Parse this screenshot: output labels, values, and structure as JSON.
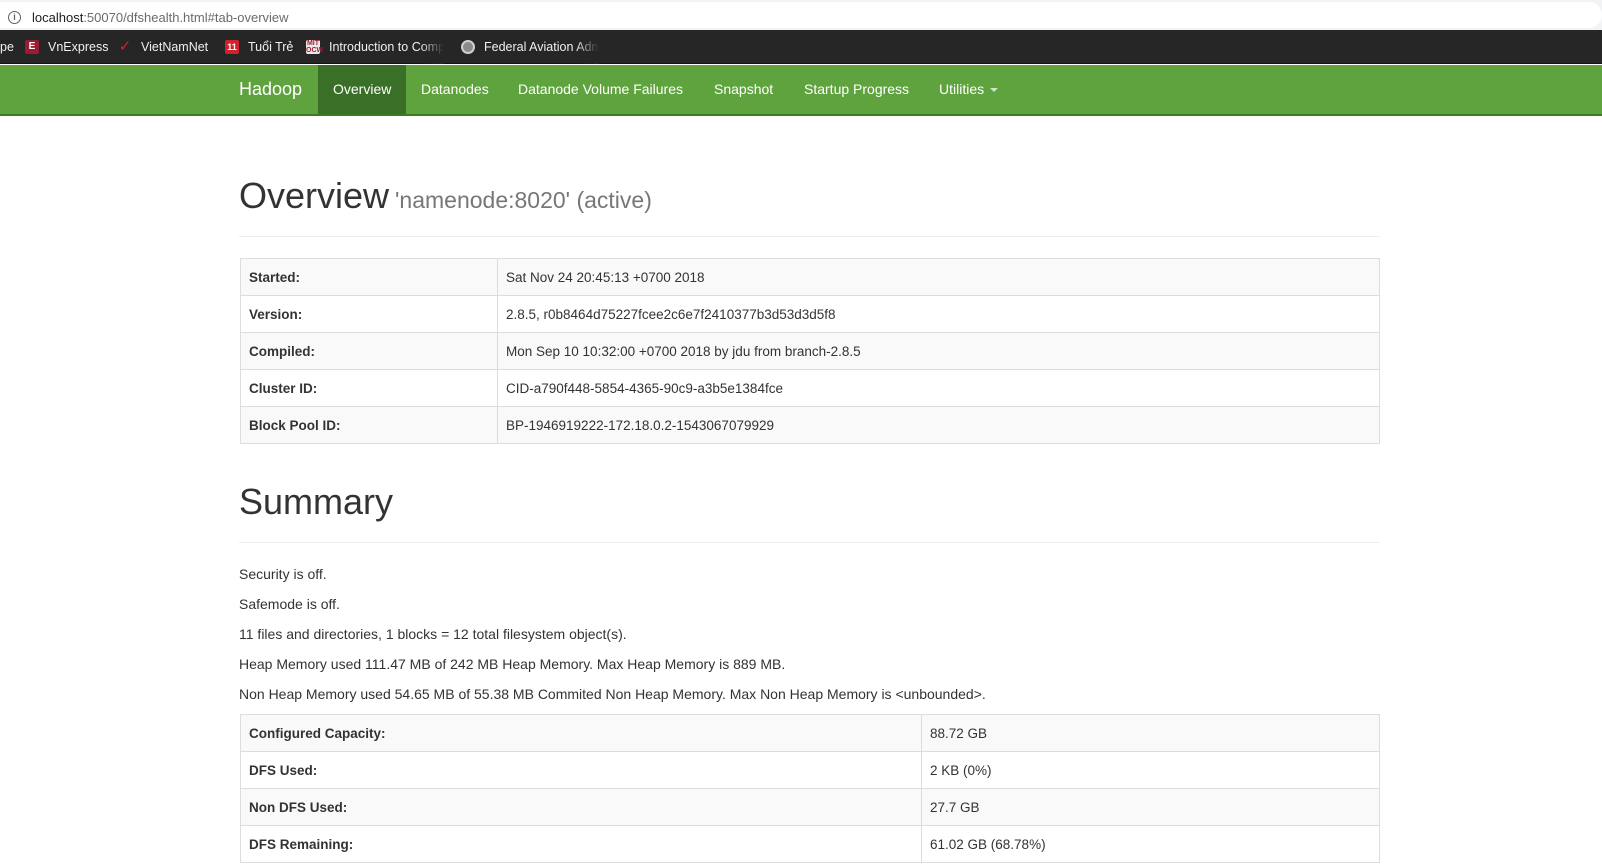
{
  "browser": {
    "url_host": "localhost",
    "url_rest": ":50070/dfshealth.html#tab-overview",
    "bookmarks": [
      {
        "label": "pe",
        "icon": "none"
      },
      {
        "label": "VnExpress",
        "icon": "vnexpress-icon"
      },
      {
        "label": "VietNamNet",
        "icon": "vietnamnet-icon"
      },
      {
        "label": "Tuổi Trẻ",
        "icon": "tuoitre-icon"
      },
      {
        "label": "Introduction to Comp",
        "icon": "mit-ocw-icon"
      },
      {
        "label": "Federal Aviation Adm",
        "icon": "faa-seal-icon"
      }
    ]
  },
  "navbar": {
    "brand": "Hadoop",
    "items": [
      {
        "label": "Overview",
        "active": true
      },
      {
        "label": "Datanodes"
      },
      {
        "label": "Datanode Volume Failures"
      },
      {
        "label": "Snapshot"
      },
      {
        "label": "Startup Progress"
      },
      {
        "label": "Utilities",
        "dropdown": true
      }
    ],
    "color": "#5fa33e",
    "active_color": "#3a6f28"
  },
  "overview": {
    "title": "Overview",
    "subtitle": "'namenode:8020' (active)",
    "rows": [
      {
        "key": "Started:",
        "value": "Sat Nov 24 20:45:13 +0700 2018"
      },
      {
        "key": "Version:",
        "value": "2.8.5, r0b8464d75227fcee2c6e7f2410377b3d53d3d5f8"
      },
      {
        "key": "Compiled:",
        "value": "Mon Sep 10 10:32:00 +0700 2018 by jdu from branch-2.8.5"
      },
      {
        "key": "Cluster ID:",
        "value": "CID-a790f448-5854-4365-90c9-a3b5e1384fce"
      },
      {
        "key": "Block Pool ID:",
        "value": "BP-1946919222-172.18.0.2-1543067079929"
      }
    ]
  },
  "summary": {
    "title": "Summary",
    "lines": [
      "Security is off.",
      "Safemode is off.",
      "11 files and directories, 1 blocks = 12 total filesystem object(s).",
      "Heap Memory used 111.47 MB of 242 MB Heap Memory. Max Heap Memory is 889 MB.",
      "Non Heap Memory used 54.65 MB of 55.38 MB Commited Non Heap Memory. Max Non Heap Memory is <unbounded>."
    ],
    "rows": [
      {
        "key": "Configured Capacity:",
        "value": "88.72 GB"
      },
      {
        "key": "DFS Used:",
        "value": "2 KB (0%)"
      },
      {
        "key": "Non DFS Used:",
        "value": "27.7 GB"
      },
      {
        "key": "DFS Remaining:",
        "value": "61.02 GB (68.78%)"
      }
    ]
  }
}
